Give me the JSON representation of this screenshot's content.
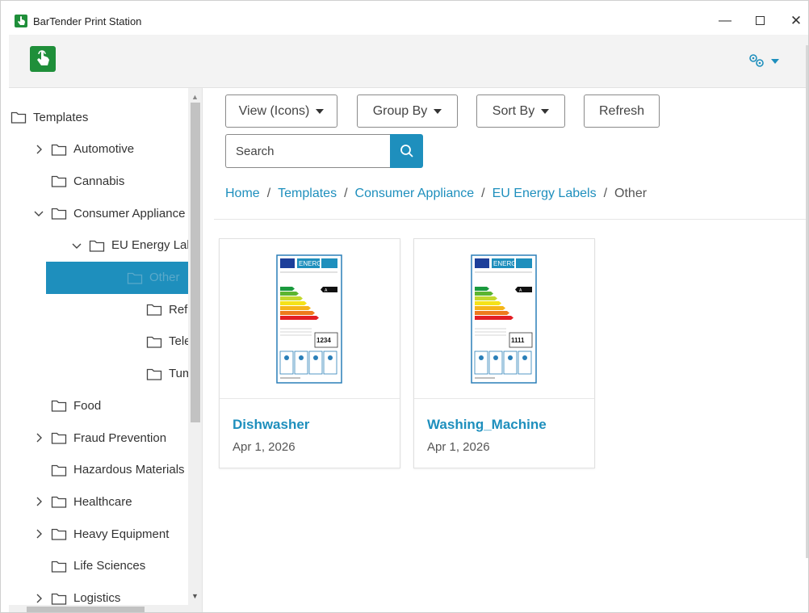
{
  "window": {
    "title": "BarTender Print Station",
    "controls": {
      "minimize": "—",
      "maximize": "",
      "close": "✕"
    }
  },
  "header": {
    "logo_icon": "touch-hand-icon",
    "settings_icon": "gears-icon"
  },
  "sidebar": {
    "items": [
      {
        "label": "Templates",
        "level": 0,
        "expander": "none"
      },
      {
        "label": "Automotive",
        "level": 1,
        "expander": "collapsed"
      },
      {
        "label": "Cannabis",
        "level": 1,
        "expander": "none"
      },
      {
        "label": "Consumer Appliance",
        "level": 1,
        "expander": "expanded"
      },
      {
        "label": "EU Energy Lab",
        "level": 2,
        "expander": "expanded"
      },
      {
        "label": "Other",
        "level": 3,
        "expander": "none",
        "selected": true
      },
      {
        "label": "Refrige",
        "level": 3,
        "expander": "none"
      },
      {
        "label": "Televisi",
        "level": 3,
        "expander": "none"
      },
      {
        "label": "Tumble",
        "level": 3,
        "expander": "none"
      },
      {
        "label": "Food",
        "level": 1,
        "expander": "none"
      },
      {
        "label": "Fraud Prevention",
        "level": 1,
        "expander": "collapsed"
      },
      {
        "label": "Hazardous Materials",
        "level": 1,
        "expander": "none"
      },
      {
        "label": "Healthcare",
        "level": 1,
        "expander": "collapsed"
      },
      {
        "label": "Heavy Equipment",
        "level": 1,
        "expander": "collapsed"
      },
      {
        "label": "Life Sciences",
        "level": 1,
        "expander": "none"
      },
      {
        "label": "Logistics",
        "level": 1,
        "expander": "collapsed"
      }
    ]
  },
  "toolbar": {
    "view_label": "View (Icons)",
    "group_label": "Group By",
    "sort_label": "Sort By",
    "refresh_label": "Refresh",
    "search_placeholder": "Search"
  },
  "breadcrumb": [
    "Home",
    "Templates",
    "Consumer Appliance",
    "EU Energy Labels",
    "Other"
  ],
  "cards": [
    {
      "name": "Dishwasher",
      "date": "Apr 1, 2026",
      "label_value": "1234"
    },
    {
      "name": "Washing_Machine",
      "date": "Apr 1, 2026",
      "label_value": "1111"
    }
  ],
  "colors": {
    "accent": "#1e8fbd",
    "brand_green": "#1f8f3a",
    "selected_bg": "#1e8fbd"
  }
}
